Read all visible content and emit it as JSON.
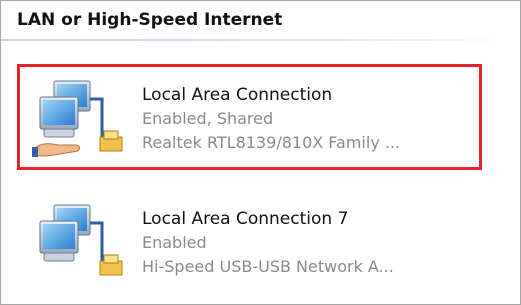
{
  "group": {
    "title": "LAN or High-Speed Internet"
  },
  "connections": [
    {
      "name": "Local Area Connection",
      "status": "Enabled, Shared",
      "device": "Realtek RTL8139/810X Family ...",
      "icon": "network-connection-shared-icon",
      "selected": true
    },
    {
      "name": "Local Area Connection 7",
      "status": "Enabled",
      "device": "Hi-Speed USB-USB Network A...",
      "icon": "network-connection-icon",
      "selected": false
    }
  ],
  "colors": {
    "selection_border": "#e3222d",
    "secondary_text": "#8a8a8a",
    "header_line": "#c9d4e6"
  }
}
